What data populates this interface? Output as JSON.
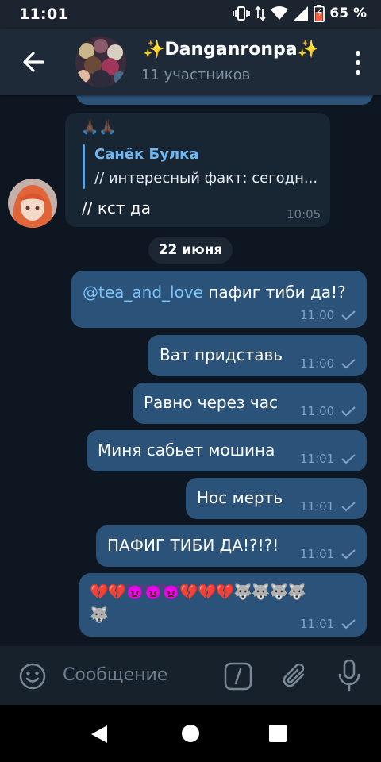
{
  "status_bar": {
    "time": "11:01",
    "battery": "65 %"
  },
  "header": {
    "title": "✨Danganronpa✨",
    "subtitle": "11 участников"
  },
  "messages_incoming": {
    "sender_emoji": "🙏🏿🙏🏿",
    "reply_name": "Санёк Булка",
    "reply_text": "// интересный факт: сегодн...",
    "text": "// кст да",
    "time": "10:05"
  },
  "date_separator": "22 июня",
  "messages_outgoing": [
    {
      "mention": "@tea_and_love",
      "text": " пафиг тиби да!?",
      "time": "11:00"
    },
    {
      "text": "Ват придставь",
      "time": "11:00"
    },
    {
      "text": "Равно через час",
      "time": "11:00"
    },
    {
      "text": "Миня сабьет мошина",
      "time": "11:01"
    },
    {
      "text": "Нос мерть",
      "time": "11:01"
    },
    {
      "text": "ПАФИГ ТИБИ ДА!?!?!",
      "time": "11:01"
    },
    {
      "text": "💔💔👿👿👿💔💔💔🐺🐺🐺🐺",
      "text2": "🐺",
      "time": "11:01"
    }
  ],
  "input": {
    "placeholder": "Сообщение"
  },
  "icons": {
    "back": "arrow-left-icon",
    "more": "more-vertical-icon",
    "emoji": "emoji-icon",
    "commands": "slash-commands-icon",
    "attach": "paperclip-icon",
    "mic": "microphone-icon",
    "read_check": "check-icon"
  },
  "colors": {
    "background": "#0e1621",
    "header": "#1e2a38",
    "bubble_out": "#2b5278",
    "bubble_in": "#182533",
    "accent": "#71b8f0"
  }
}
